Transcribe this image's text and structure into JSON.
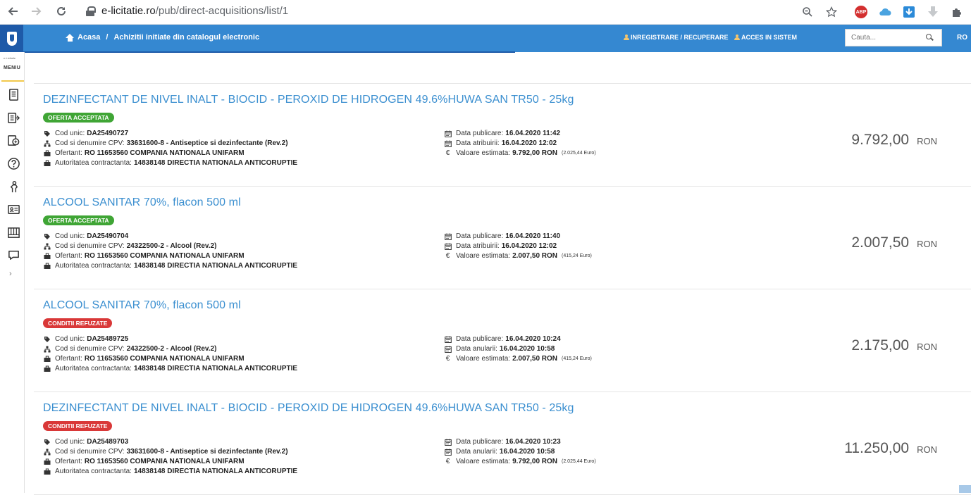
{
  "browser": {
    "url_host": "e-licitatie.ro",
    "url_path": "/pub/direct-acquisitions/list/1"
  },
  "header": {
    "breadcrumb_home": "Acasa",
    "breadcrumb_sep": "/",
    "breadcrumb_current": "Achizitii initiate din catalogul electronic",
    "register_link": "INREGISTRARE / RECUPERARE",
    "login_link": "ACCES IN SISTEM",
    "search_placeholder": "Cauta...",
    "language": "RO"
  },
  "sidebar": {
    "small_label": "e-Licitatie",
    "menu_label": "MENIU",
    "icons": [
      "document-list-icon",
      "export-list-icon",
      "calculator-icon",
      "help-icon",
      "person-pointer-icon",
      "id-card-icon",
      "reports-icon",
      "chat-icon"
    ]
  },
  "labels": {
    "cod_unic": "Cod unic:",
    "cpv": "Cod si denumire CPV:",
    "ofertant": "Ofertant:",
    "autoritatea": "Autoritatea contractanta:",
    "data_publicare": "Data publicare:",
    "valoare_estimata": "Valoare estimata:"
  },
  "items": [
    {
      "title": "DEZINFECTANT DE NIVEL INALT - BIOCID - PEROXID DE HIDROGEN 49.6%HUWA SAN TR50 - 25kg",
      "status": "OFERTA ACCEPTATA",
      "status_color": "#3fa535",
      "cod_unic": "DA25490727",
      "cpv": "33631600-8 - Antiseptice si dezinfectante (Rev.2)",
      "ofertant": "RO 11653560 COMPANIA NATIONALA UNIFARM",
      "autoritatea": "14838148 DIRECTIA NATIONALA ANTICORUPTIE",
      "data_publicare": "16.04.2020 11:42",
      "second_date_label": "Data atribuirii:",
      "second_date": "16.04.2020 12:02",
      "valoare_estimata": "9.792,00 RON",
      "valoare_euro": "(2.025,44 Euro)",
      "price": "9.792,00",
      "currency": "RON"
    },
    {
      "title": "ALCOOL SANITAR 70%, flacon 500 ml",
      "status": "OFERTA ACCEPTATA",
      "status_color": "#3fa535",
      "cod_unic": "DA25490704",
      "cpv": "24322500-2 - Alcool (Rev.2)",
      "ofertant": "RO 11653560 COMPANIA NATIONALA UNIFARM",
      "autoritatea": "14838148 DIRECTIA NATIONALA ANTICORUPTIE",
      "data_publicare": "16.04.2020 11:40",
      "second_date_label": "Data atribuirii:",
      "second_date": "16.04.2020 12:02",
      "valoare_estimata": "2.007,50 RON",
      "valoare_euro": "(415,24 Euro)",
      "price": "2.007,50",
      "currency": "RON"
    },
    {
      "title": "ALCOOL SANITAR 70%, flacon 500 ml",
      "status": "CONDITII REFUZATE",
      "status_color": "#d93838",
      "cod_unic": "DA25489725",
      "cpv": "24322500-2 - Alcool (Rev.2)",
      "ofertant": "RO 11653560 COMPANIA NATIONALA UNIFARM",
      "autoritatea": "14838148 DIRECTIA NATIONALA ANTICORUPTIE",
      "data_publicare": "16.04.2020 10:24",
      "second_date_label": "Data anularii:",
      "second_date": "16.04.2020 10:58",
      "valoare_estimata": "2.007,50 RON",
      "valoare_euro": "(415,24 Euro)",
      "price": "2.175,00",
      "currency": "RON"
    },
    {
      "title": "DEZINFECTANT DE NIVEL INALT - BIOCID - PEROXID DE HIDROGEN 49.6%HUWA SAN TR50 - 25kg",
      "status": "CONDITII REFUZATE",
      "status_color": "#d93838",
      "cod_unic": "DA25489703",
      "cpv": "33631600-8 - Antiseptice si dezinfectante (Rev.2)",
      "ofertant": "RO 11653560 COMPANIA NATIONALA UNIFARM",
      "autoritatea": "14838148 DIRECTIA NATIONALA ANTICORUPTIE",
      "data_publicare": "16.04.2020 10:23",
      "second_date_label": "Data anularii:",
      "second_date": "16.04.2020 10:58",
      "valoare_estimata": "9.792,00 RON",
      "valoare_euro": "(2.025,44 Euro)",
      "price": "11.250,00",
      "currency": "RON"
    }
  ]
}
